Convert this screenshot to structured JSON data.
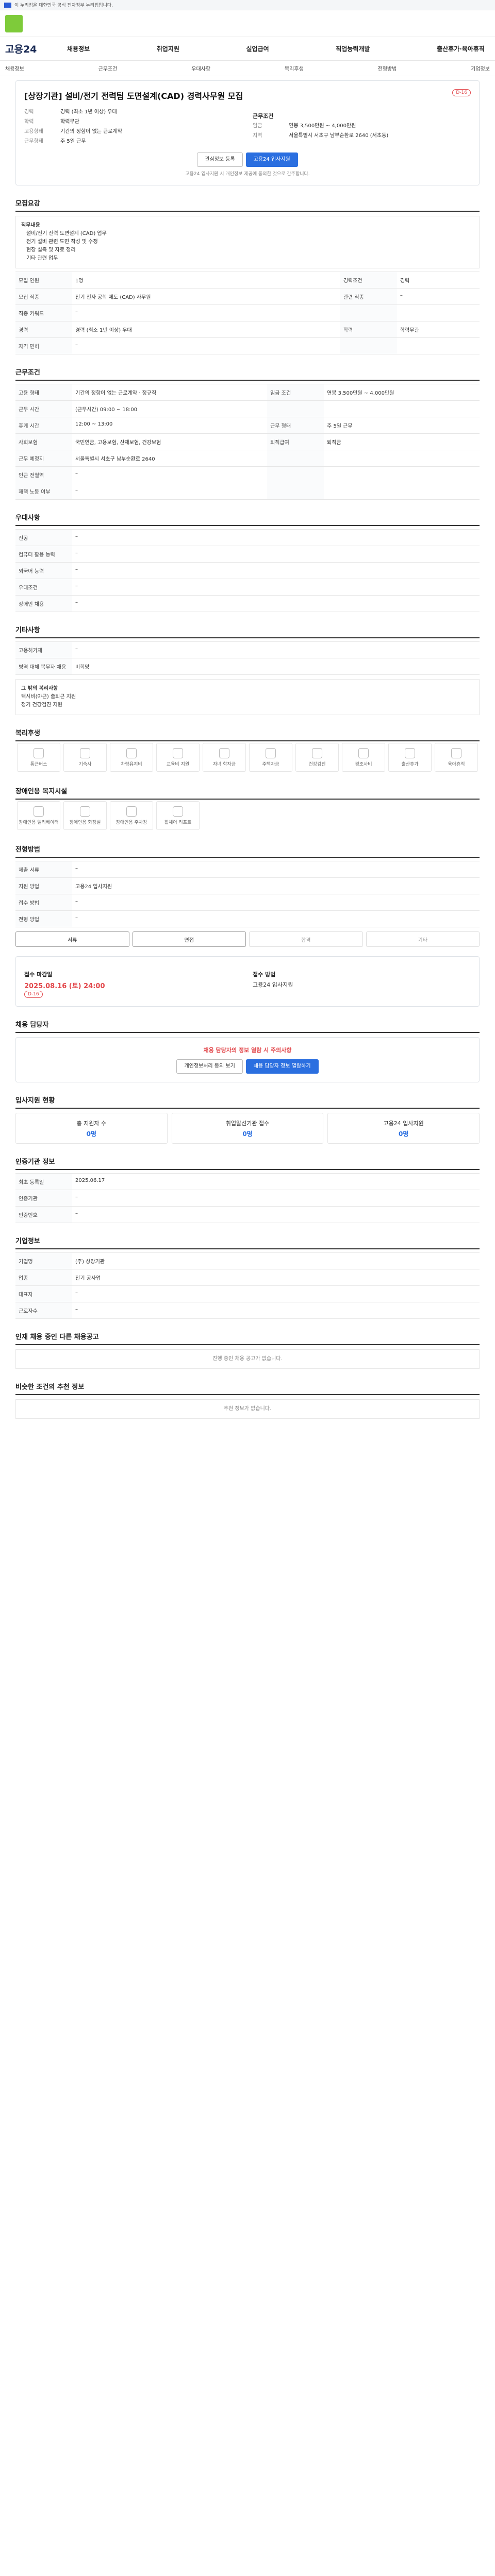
{
  "topbar": {
    "text": "이 누리집은 대한민국 공식 전자정부 누리집입니다."
  },
  "header": {
    "brand": "고용24",
    "nav": [
      "채용정보",
      "취업지원",
      "실업급여",
      "직업능력개발",
      "출산휴가·육아휴직"
    ],
    "subnav": [
      "채용정보",
      "근무조건",
      "우대사항",
      "복리후생",
      "전형방법",
      "기업정보"
    ]
  },
  "job": {
    "badge": "D-16",
    "title": "[상장기관] 설비/전기 전력팀 도면설계(CAD) 경력사무원 모집",
    "company_label": "회사명",
    "company": "",
    "location_label": "지역",
    "location": "대전 대덕구 ...",
    "career_label": "경력",
    "career": "경력 (최소 1년 이상) 우대",
    "edu_label": "학력",
    "edu": "학력무관",
    "cond_label": "근무조건",
    "pay_label": "임금",
    "pay": "연봉 3,500만원 ~ 4,000만원",
    "place_label": "지역",
    "place": "서울특별시 서초구 남부순환로 2640 (서초동)",
    "form_label": "고용형태",
    "form": "기간의 정함이 없는 근로계약",
    "hours_label": "근무형태",
    "hours": "주 5일 근무",
    "btn_save": "관심정보 등록",
    "btn_apply": "고용24 입사지원",
    "notice": "고용24 입사지원 시 개인정보 제공에 동의한 것으로 간주합니다."
  },
  "sections": {
    "recruit": "모집요강",
    "work": "근무조건",
    "pref": "우대사항",
    "etc": "기타사항",
    "welfare": "복리후생",
    "disabled": "장애인용 복지시설",
    "selection": "전형방법",
    "contact": "채용 담당자",
    "stats": "입사지원 현황",
    "cert": "인증기관 정보",
    "company": "기업정보",
    "other": "인재 채용 중인 다른 채용공고",
    "similar": "비슷한 조건의 추천 정보"
  },
  "recruit": {
    "duty_label": "직무내용",
    "duty": [
      "설비/전기 전력 도면설계 (CAD) 업무",
      "전기 설비 관련 도면 작성 및 수정",
      "현장 실측 및 자료 정리",
      "기타 관련 업무"
    ],
    "rows": [
      {
        "k": "모집 인원",
        "v": "1명",
        "k2": "경력조건",
        "v2": "경력"
      },
      {
        "k": "모집 직종",
        "v": "전기 전자 공학 제도 (CAD) 사무원",
        "k2": "관련 직종",
        "v2": "–"
      },
      {
        "k": "직종 키워드",
        "v": "–",
        "k2": "",
        "v2": ""
      },
      {
        "k": "경력",
        "v": "경력 (최소 1년 이상) 우대",
        "k2": "학력",
        "v2": "학력무관"
      },
      {
        "k": "자격 면허",
        "v": "–",
        "k2": "",
        "v2": ""
      }
    ]
  },
  "work": {
    "rows": [
      {
        "k": "고용 형태",
        "v": "기간의 정함이 없는 근로계약 · 정규직",
        "k2": "임금 조건",
        "v2": "연봉 3,500만원 ~ 4,000만원"
      },
      {
        "k": "근무 시간",
        "v": "(근무시간) 09:00 ~ 18:00",
        "k2": "",
        "v2": ""
      },
      {
        "k": "휴게 시간",
        "v": "12:00 ~ 13:00",
        "k2": "근무 형태",
        "v2": "주 5일 근무"
      },
      {
        "k": "사회보험",
        "v": "국민연금, 고용보험, 산재보험, 건강보험",
        "k2": "퇴직급여",
        "v2": "퇴직금"
      },
      {
        "k": "근무 예정지",
        "v": "서울특별시 서초구 남부순환로 2640",
        "k2": "",
        "v2": ""
      },
      {
        "k": "인근 전철역",
        "v": "–",
        "k2": "",
        "v2": ""
      },
      {
        "k": "재택 노동 여부",
        "v": "–",
        "k2": "",
        "v2": ""
      }
    ]
  },
  "pref": {
    "rows": [
      {
        "k": "전공",
        "v": "–"
      },
      {
        "k": "컴퓨터 활용 능력",
        "v": "–"
      },
      {
        "k": "외국어 능력",
        "v": "–"
      },
      {
        "k": "우대조건",
        "v": "–"
      },
      {
        "k": "장애인 채용",
        "v": "–"
      }
    ]
  },
  "etc": {
    "rows": [
      {
        "k": "고용허가제",
        "v": "–"
      },
      {
        "k": "병역 대체 복무자 채용",
        "v": "비희망"
      }
    ],
    "extra_label": "그 밖의 복리사항",
    "extra": [
      "택시비(야근) 출퇴근 지원",
      "정기 건강검진 지원"
    ]
  },
  "welfare": {
    "items": [
      "통근버스",
      "기숙사",
      "차량유지비",
      "교육비 지원",
      "자녀 학자금",
      "주택자금",
      "건강검진",
      "경조사비",
      "출산휴가",
      "육아휴직"
    ]
  },
  "disabled": {
    "items": [
      "장애인용 엘리베이터",
      "장애인용 화장실",
      "장애인용 주차장",
      "휠체어 리프트"
    ]
  },
  "selection": {
    "rows": [
      {
        "k": "제출 서류",
        "v": "–"
      },
      {
        "k": "지원 방법",
        "v": "고용24 입사지원"
      },
      {
        "k": "접수 방법",
        "v": "–"
      },
      {
        "k": "전형 방법",
        "v": "–"
      }
    ],
    "steps": [
      "서류",
      "면접",
      "합격",
      "기타"
    ]
  },
  "contact": {
    "deadline_label": "접수 마감일",
    "deadline": "2025.08.16 (토) 24:00",
    "d": "D-16",
    "apply_label": "접수 방법",
    "apply": "고용24 입사지원",
    "alert": "채용 담당자의 정보 열람 시 주의사항",
    "btn1": "개인정보처리 동의 보기",
    "btn2": "채용 담당자 정보 열람하기"
  },
  "stats": {
    "items": [
      {
        "label": "총 지원자 수",
        "value": "0명"
      },
      {
        "label": "취업알선기관 접수",
        "value": "0명"
      },
      {
        "label": "고용24 입사지원",
        "value": "0명"
      }
    ]
  },
  "cert": {
    "rows": [
      {
        "k": "최초 등록일",
        "v": "2025.06.17"
      },
      {
        "k": "인증기관",
        "v": "–"
      },
      {
        "k": "인증번호",
        "v": "–"
      }
    ]
  },
  "company": {
    "rows": [
      {
        "k": "기업명",
        "v": "(주) 상장기관"
      },
      {
        "k": "업종",
        "v": "전기 공사업"
      },
      {
        "k": "대표자",
        "v": "–"
      },
      {
        "k": "근로자수",
        "v": "–"
      }
    ]
  },
  "other": {
    "empty": "진행 중인 채용 공고가 없습니다."
  },
  "similar": {
    "empty": "추천 정보가 없습니다."
  }
}
